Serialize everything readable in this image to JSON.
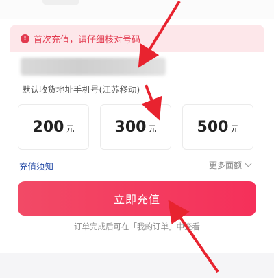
{
  "notice": {
    "text": "首次充值，请仔细核对号码",
    "icon": "warning-icon"
  },
  "phone": {
    "hint": "默认收货地址手机号(江苏移动)"
  },
  "amounts": [
    {
      "value": "200",
      "unit": "元"
    },
    {
      "value": "300",
      "unit": "元"
    },
    {
      "value": "500",
      "unit": "元"
    }
  ],
  "links": {
    "recharge_notes": "充值须知",
    "more_amounts": "更多面额"
  },
  "action": {
    "recharge_label": "立即充值"
  },
  "footer": {
    "hint": "订单完成后可在「我的订单」中查看"
  },
  "colors": {
    "accent": "#f23a5e",
    "notice_bg": "#fde7ea",
    "annotation_arrow": "#e8232f"
  }
}
